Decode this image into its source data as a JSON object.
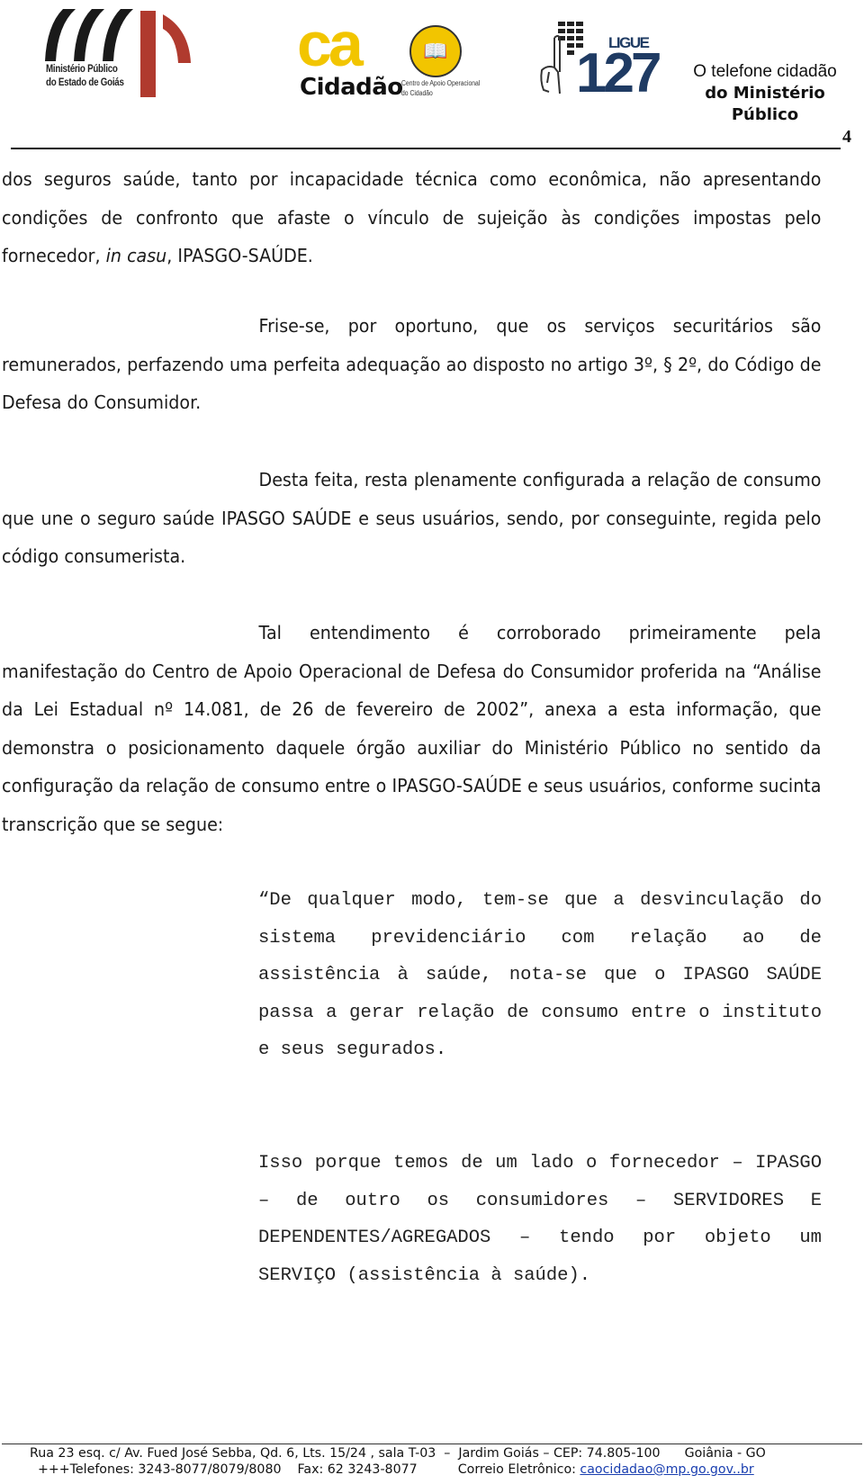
{
  "header": {
    "logo_mp": {
      "line1": "Ministério Público",
      "line2": "do Estado de Goiás",
      "colors": {
        "arcs": "#1a1a1a",
        "accent": "#b03a2e"
      }
    },
    "logo_cao": {
      "word": "ca",
      "title": "Cidadão",
      "subtitle_line1": "Centro de Apoio Operacional",
      "subtitle_line2": "do Cidadão",
      "colors": {
        "brand": "#f2c500"
      }
    },
    "logo_127": {
      "ligue": "LIGUE",
      "number": "127",
      "color": "#1f3b63"
    },
    "tagline": {
      "line1": "O telefone cidadão",
      "line2": "do Ministério",
      "line3": "Público"
    },
    "page_number": "4"
  },
  "paragraphs": {
    "p1": {
      "before_italic": "dos seguros saúde, tanto por incapacidade técnica como econômica, não apresentando condições de confronto que afaste o vínculo de sujeição às condições impostas pelo fornecedor, ",
      "italic": "in casu",
      "after_italic": ", IPASGO-SAÚDE."
    },
    "p2": "Frise-se, por oportuno,  que os serviços securitários são remunerados, perfazendo uma perfeita adequação ao disposto no artigo 3º, § 2º, do Código de Defesa do Consumidor.",
    "p3": "Desta feita, resta plenamente configurada a relação de consumo que une o seguro saúde IPASGO SAÚDE e seus usuários, sendo, por conseguinte, regida pelo código consumerista.",
    "p4": "Tal entendimento é corroborado primeiramente pela manifestação do Centro de Apoio Operacional de Defesa do Consumidor proferida na “Análise da Lei Estadual nº 14.081, de 26 de fevereiro de 2002”, anexa a esta informação, que demonstra o posicionamento daquele órgão auxiliar do Ministério Público no sentido da configuração da relação de consumo entre o IPASGO-SAÚDE e seus usuários, conforme sucinta transcrição que se segue:"
  },
  "quote": {
    "q1": "“De qualquer modo, tem-se que a desvinculação do sistema previdenciário com relação ao de assistência à saúde, nota-se que o IPASGO SAÚDE passa a gerar relação de consumo entre o instituto e seus segurados.",
    "q2": "Isso porque temos de um lado o fornecedor – IPASGO – de outro os consumidores – SERVIDORES E DEPENDENTES/AGREGADOS – tendo por objeto um SERVIÇO (assistência à saúde)."
  },
  "footer": {
    "line1": "Rua 23 esq. c/ Av. Fued José Sebba, Qd. 6, Lts. 15/24 , sala T-03  –  Jardim Goiás – CEP: 74.805-100      Goiânia - GO",
    "line2_prefix": "+++Telefones: 3243-8077/8079/8080    Fax: 62 3243-8077          Correio Eletrônico: ",
    "email": "caocidadao@mp.go.gov..br",
    "link_color": "#1a3fb0"
  }
}
